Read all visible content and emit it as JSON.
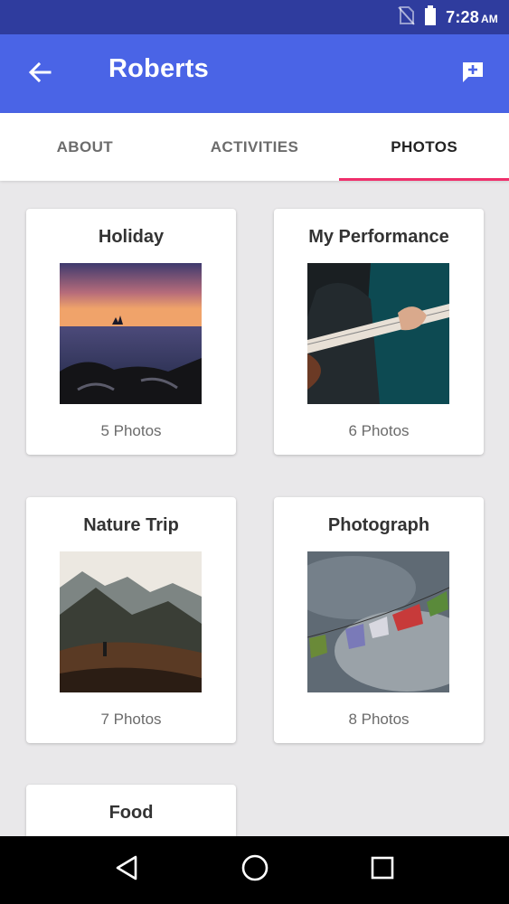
{
  "status_bar": {
    "time": "7:28",
    "ampm": "AM"
  },
  "app_bar": {
    "title": "Roberts"
  },
  "tabs": [
    {
      "label": "ABOUT",
      "active": false
    },
    {
      "label": "ACTIVITIES",
      "active": false
    },
    {
      "label": "PHOTOS",
      "active": true
    }
  ],
  "albums": [
    {
      "title": "Holiday",
      "count": "5 Photos"
    },
    {
      "title": "My Performance",
      "count": "6 Photos"
    },
    {
      "title": "Nature Trip",
      "count": "7 Photos"
    },
    {
      "title": "Photograph",
      "count": "8 Photos"
    },
    {
      "title": "Food",
      "count": ""
    }
  ],
  "colors": {
    "status_bar": "#2f3c9e",
    "app_bar": "#4a64e6",
    "tab_indicator": "#ef2f6b",
    "background": "#e9e8ea"
  },
  "icons": {
    "back": "arrow-back-icon",
    "message": "add-comment-icon",
    "nav_back": "triangle-back-icon",
    "nav_home": "circle-home-icon",
    "nav_recents": "square-recents-icon"
  }
}
